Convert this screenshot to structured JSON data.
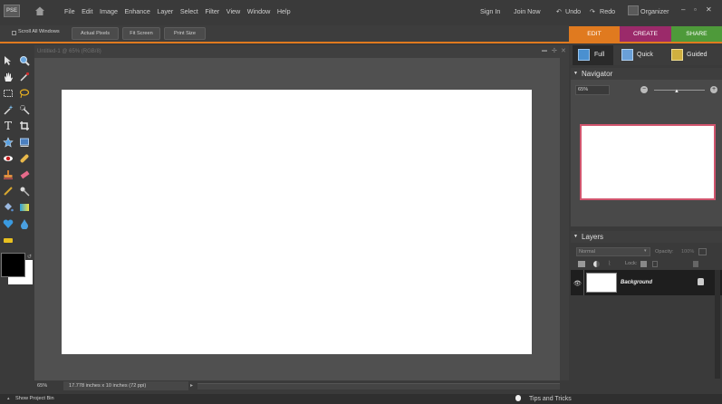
{
  "app": {
    "logo_text": "PSE"
  },
  "menu": {
    "items": [
      "File",
      "Edit",
      "Image",
      "Enhance",
      "Layer",
      "Select",
      "Filter",
      "View",
      "Window",
      "Help"
    ]
  },
  "header": {
    "sign_in": "Sign In",
    "join_now": "Join Now",
    "undo": "Undo",
    "redo": "Redo",
    "organizer": "Organizer"
  },
  "options": {
    "scroll_all": "Scroll All Windows",
    "actual_pixels": "Actual Pixels",
    "fit_screen": "Fit Screen",
    "print_size": "Print Size"
  },
  "modes": {
    "edit": "EDIT",
    "create": "CREATE",
    "share": "SHARE"
  },
  "edit_modes": {
    "full": "Full",
    "quick": "Quick",
    "guided": "Guided"
  },
  "document": {
    "title": "Untitled-1 @ 65% (RGB/8)",
    "zoom": "65%",
    "size_info": "17.778 inches x 10 inches (72 ppi)"
  },
  "navigator": {
    "title": "Navigator",
    "zoom": "65%"
  },
  "layers": {
    "title": "Layers",
    "blend": "Normal",
    "opacity_label": "Opacity:",
    "opacity_value": "100%",
    "lock_label": "Lock:",
    "layer_name": "Background"
  },
  "bottom": {
    "show_bin": "Show Project Bin",
    "tips": "Tips and Tricks"
  },
  "colors": {
    "accent": "#e07a1f",
    "edit_tab": "#e07a1f",
    "create_tab": "#9b2a6a",
    "share_tab": "#4e9a3a"
  }
}
